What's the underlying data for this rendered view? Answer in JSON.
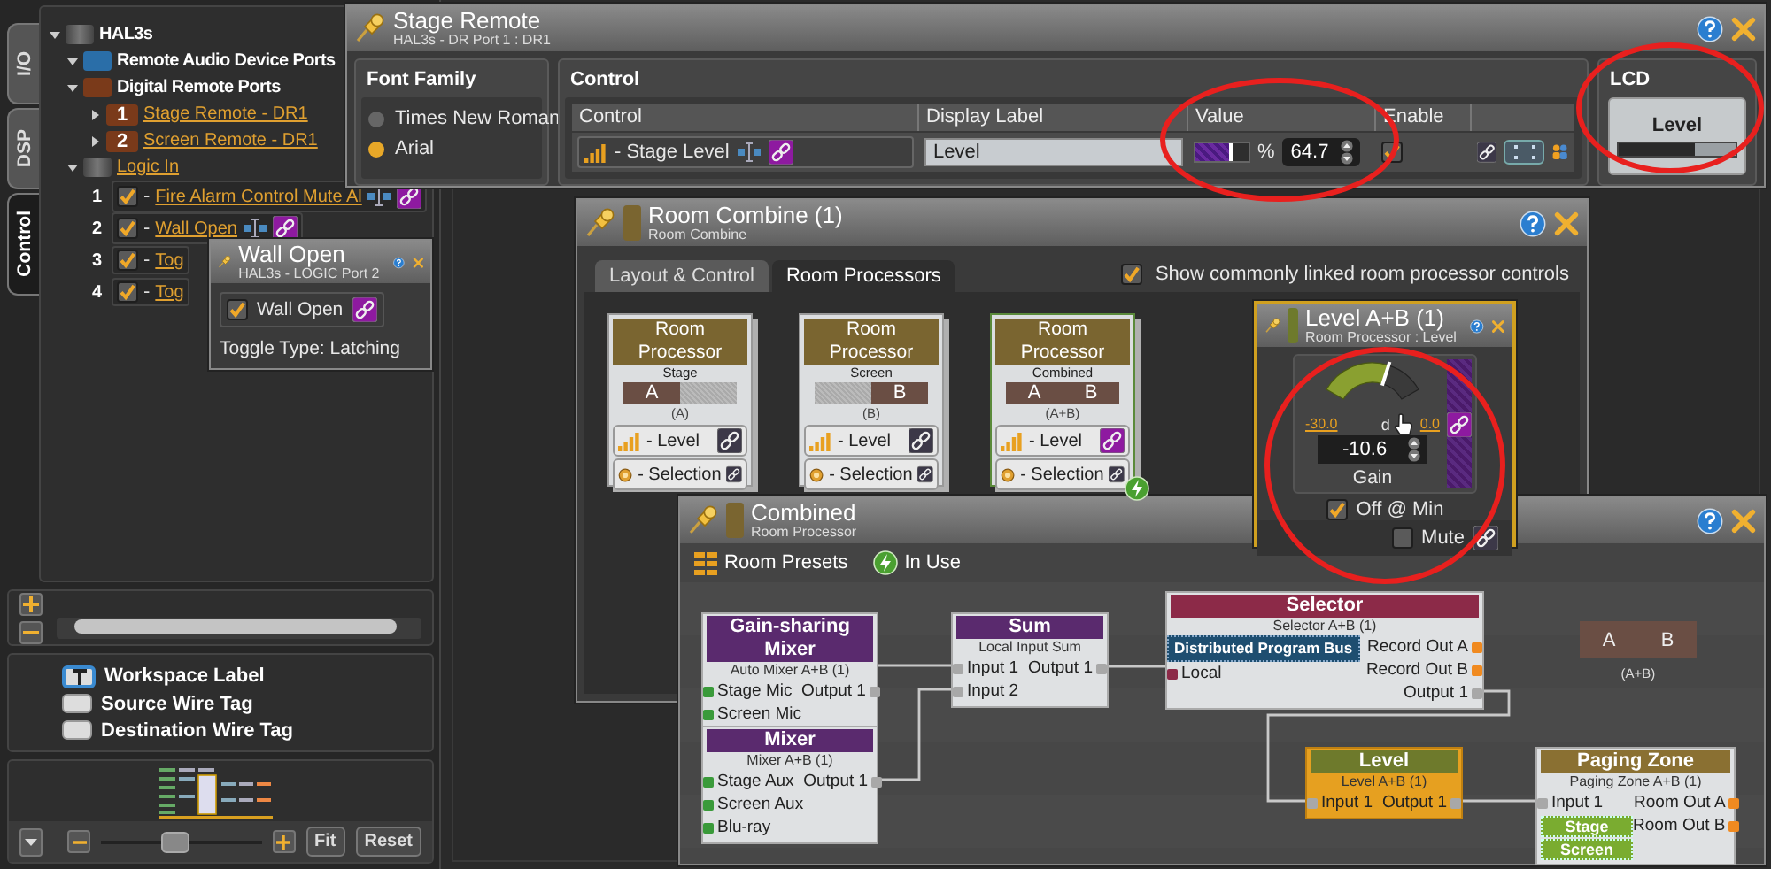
{
  "side_tabs": [
    {
      "label": "I/O",
      "selected": false
    },
    {
      "label": "DSP",
      "selected": false
    },
    {
      "label": "Control",
      "selected": true
    }
  ],
  "tree": {
    "label": "HAL3s",
    "expanded": true,
    "groups": [
      {
        "label": "Remote Audio Device Ports",
        "kind": "audio",
        "expanded": true
      },
      {
        "label": "Digital Remote Ports",
        "kind": "remote",
        "expanded": true,
        "children": [
          {
            "number": "1",
            "label": "Stage Remote - DR1",
            "expanded": false
          },
          {
            "number": "2",
            "label": "Screen Remote - DR1",
            "expanded": false
          }
        ]
      },
      {
        "label": "Logic In",
        "kind": "logic",
        "expanded": true,
        "inputs": [
          {
            "number": "1",
            "prefix": "-",
            "label": "Fire Alarm Control Mute Al",
            "checked": true,
            "mapped": true
          },
          {
            "number": "2",
            "prefix": "-",
            "label": "Wall Open",
            "checked": true,
            "mapped": true
          },
          {
            "number": "3",
            "prefix": "-",
            "label": "Tog",
            "checked": true
          },
          {
            "number": "4",
            "prefix": "-",
            "label": "Tog",
            "checked": true
          }
        ]
      }
    ]
  },
  "wire_tags": [
    {
      "label": "Workspace Label",
      "kind": "label"
    },
    {
      "label": "Source Wire Tag",
      "kind": "source"
    },
    {
      "label": "Destination Wire Tag",
      "kind": "destination"
    }
  ],
  "navigator": {
    "level": 0.45,
    "buttons": [
      "Fit",
      "Reset"
    ]
  },
  "wall_open": {
    "title": "Wall Open",
    "subtitle": "HAL3s - LOGIC Port 2",
    "toggle": {
      "label": "Wall Open",
      "checked": true
    },
    "note": "Toggle Type: Latching"
  },
  "stage_remote": {
    "title": "Stage Remote",
    "subtitle": "HAL3s - DR Port 1 : DR1",
    "font_family": {
      "title": "Font Family",
      "options": [
        {
          "label": "Times New Roman",
          "selected": false
        },
        {
          "label": "Arial",
          "selected": true
        }
      ]
    },
    "control": {
      "title": "Control",
      "columns": [
        "Control",
        "Display Label",
        "Value",
        "Enable"
      ],
      "rows": [
        {
          "name": "- Stage Level",
          "display_label": "Level",
          "level": 0.647,
          "unit": "%",
          "value": "64.7",
          "enabled": true
        }
      ]
    },
    "lcd": {
      "title": "LCD",
      "label": "Level",
      "level": 0.647
    }
  },
  "room_combine": {
    "title": "Room Combine (1)",
    "subtitle": "Room Combine",
    "tabs": [
      {
        "label": "Layout & Control",
        "selected": false
      },
      {
        "label": "Room Processors",
        "selected": true
      }
    ],
    "show_linked": {
      "label": "Show commonly linked room processor controls",
      "checked": true
    },
    "cards": [
      {
        "header": "Room Processor",
        "name": "Stage",
        "rooms": [
          {
            "label": "A",
            "active": true
          },
          {
            "active": false
          }
        ],
        "caption": "(A)",
        "in_use": false,
        "controls": [
          {
            "label": "- Level",
            "kind": "level",
            "linked": false
          },
          {
            "label": "- Selection",
            "kind": "selection",
            "linked": false
          }
        ]
      },
      {
        "header": "Room Processor",
        "name": "Screen",
        "rooms": [
          {
            "active": false
          },
          {
            "label": "B",
            "active": true
          }
        ],
        "caption": "(B)",
        "in_use": false,
        "controls": [
          {
            "label": "- Level",
            "kind": "level",
            "linked": false
          },
          {
            "label": "- Selection",
            "kind": "selection",
            "linked": false
          }
        ]
      },
      {
        "header": "Room Processor",
        "name": "Combined",
        "rooms": [
          {
            "label": "A",
            "active": true
          },
          {
            "label": "B",
            "active": true
          }
        ],
        "caption": "(A+B)",
        "in_use": true,
        "controls": [
          {
            "label": "- Level",
            "kind": "level",
            "linked": true
          },
          {
            "label": "- Selection",
            "kind": "selection",
            "linked": false
          }
        ]
      }
    ]
  },
  "level_popup": {
    "title": "Level A+B (1)",
    "subtitle": "Room Processor : Level",
    "gauge": {
      "level": 0.647,
      "min": "-30.0",
      "max": "0.0",
      "unit": "d",
      "value": "-10.6",
      "label": "Gain"
    },
    "off_at_min": {
      "label": "Off @ Min",
      "checked": true
    },
    "mute": {
      "label": "Mute",
      "checked": false
    }
  },
  "combined": {
    "title": "Combined",
    "subtitle": "Room Processor",
    "toolbar": [
      {
        "label": "Room Presets",
        "kind": "presets"
      },
      {
        "label": "In Use",
        "kind": "in_use"
      }
    ],
    "nodes": [
      {
        "title": "Gain-sharing Mixer",
        "subtitle": "Auto Mixer A+B (1)",
        "color": "#5a2a6e",
        "selected": false,
        "inputs": [
          {
            "label": "Stage Mic",
            "kind": "source"
          },
          {
            "label": "Screen Mic",
            "kind": "source"
          }
        ],
        "outputs": [
          {
            "label": "Output 1",
            "kind": "wired"
          }
        ]
      },
      {
        "title": "Mixer",
        "subtitle": "Mixer A+B (1)",
        "color": "#5a2a6e",
        "selected": false,
        "inputs": [
          {
            "label": "Stage Aux",
            "kind": "source"
          },
          {
            "label": "Screen Aux",
            "kind": "source"
          },
          {
            "label": "Blu-ray",
            "kind": "source"
          }
        ],
        "outputs": [
          {
            "label": "Output 1",
            "kind": "wired"
          }
        ]
      },
      {
        "title": "Sum",
        "subtitle": "Local Input Sum",
        "color": "#5a2a6e",
        "selected": false,
        "inputs": [
          {
            "label": "Input 1",
            "kind": "wired"
          },
          {
            "label": "Input 2",
            "kind": "wired"
          }
        ],
        "outputs": [
          {
            "label": "Output 1",
            "kind": "wired"
          }
        ]
      },
      {
        "title": "Selector",
        "subtitle": "Selector A+B (1)",
        "color": "#8c2a48",
        "selected": false,
        "tag": "Distributed Program Bus",
        "inputs": [
          {
            "label": "Local",
            "kind": "bus"
          }
        ],
        "outputs": [
          {
            "label": "Record Out A",
            "kind": "open"
          },
          {
            "label": "Record Out B",
            "kind": "open"
          },
          {
            "label": "Output 1",
            "kind": "wired"
          }
        ]
      },
      {
        "title": "Level",
        "subtitle": "Level A+B (1)",
        "color": "#6e7a2c",
        "selected": true,
        "inputs": [
          {
            "label": "Input 1",
            "kind": "wired"
          }
        ],
        "outputs": [
          {
            "label": "Output 1",
            "kind": "wired"
          }
        ]
      },
      {
        "title": "Paging Zone",
        "subtitle": "Paging Zone A+B (1)",
        "color": "#8a7032",
        "selected": false,
        "inputs": [
          {
            "label": "Input 1",
            "kind": "wired"
          }
        ],
        "outputs": [
          {
            "label": "Room Out A",
            "kind": "open"
          },
          {
            "label": "Room Out B",
            "kind": "open"
          }
        ],
        "zones": [
          "Stage",
          "Screen"
        ]
      }
    ],
    "room_block": {
      "rooms": [
        "A",
        "B"
      ],
      "caption": "(A+B)"
    }
  }
}
